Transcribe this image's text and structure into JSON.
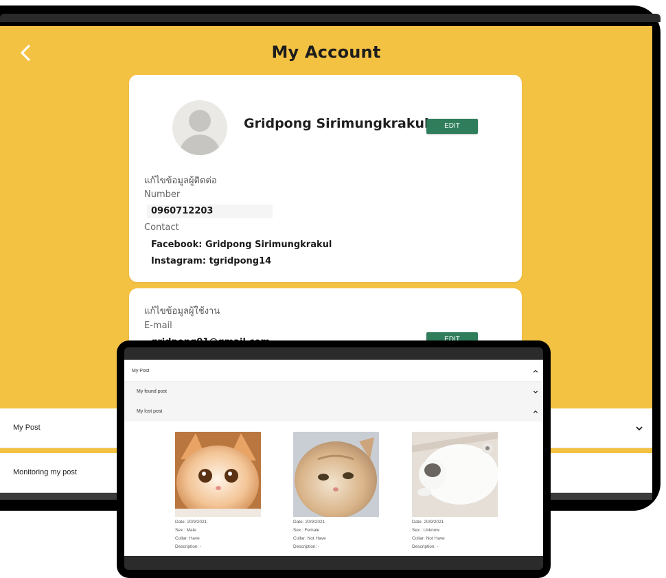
{
  "header": {
    "title": "My Account"
  },
  "profile": {
    "name": "Gridpong Sirimungkrakul",
    "edit_label": "EDIT",
    "contact_section": "แก้ไขข้อมูลผู้ติดต่อ",
    "number_label": "Number",
    "number_value": "0960712203",
    "contact_label": "Contact",
    "facebook": "Facebook: Gridpong Sirimungkrakul",
    "instagram": "Instagram: tgridpong14"
  },
  "user": {
    "section": "แก้ไขข้อมูลผู้ใช้งาน",
    "email_label": "E-mail",
    "email_value": "gridpong01@gmail.com",
    "edit_label": "EDIT"
  },
  "back_accordion": {
    "my_post": "My Post",
    "monitoring": "Monitoring my post"
  },
  "front": {
    "my_post": "My Post",
    "found": "My found post",
    "lost": "My lost post",
    "posts": [
      {
        "date": "Date: 20/9/2021",
        "sex": "Sex : Male",
        "collar": "Collar: Have",
        "description": "Description: -"
      },
      {
        "date": "Date: 20/9/2021",
        "sex": "Sex : Female",
        "collar": "Collar: Not Have",
        "description": "Description: -"
      },
      {
        "date": "Date: 20/9/2021",
        "sex": "Sex : Unknow",
        "collar": "Collar: Not Have",
        "description": "Description: -"
      }
    ]
  },
  "colors": {
    "background_yellow": "#f4c243",
    "edit_green": "#2f7d5b",
    "device_black": "#000000"
  },
  "icons": [
    "chevron-left-icon",
    "chevron-down-icon",
    "chevron-up-icon",
    "avatar-placeholder-icon"
  ]
}
